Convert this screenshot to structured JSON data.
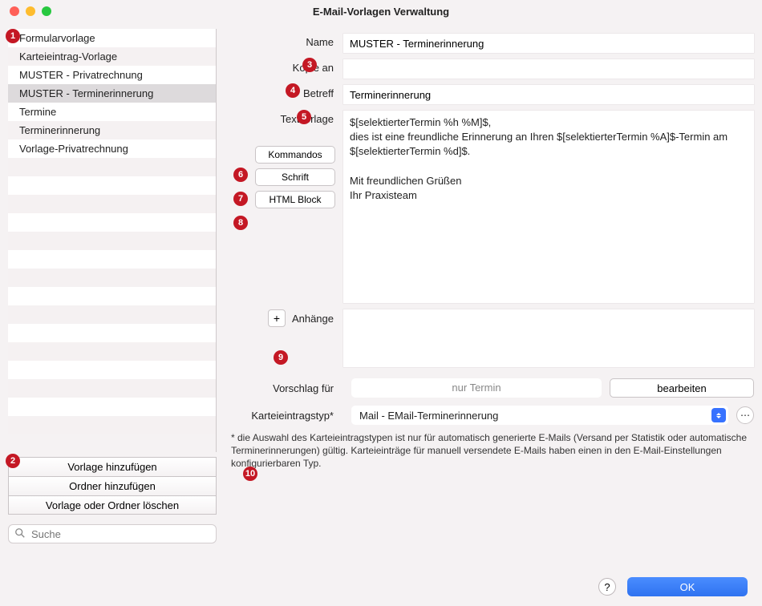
{
  "window": {
    "title": "E-Mail-Vorlagen Verwaltung"
  },
  "sidebar": {
    "items": [
      "Formularvorlage",
      "Karteieintrag-Vorlage",
      "MUSTER - Privatrechnung",
      "MUSTER - Terminerinnerung",
      "Termine",
      "Terminerinnerung",
      "Vorlage-Privatrechnung"
    ],
    "selected_index": 3,
    "buttons": {
      "add_template": "Vorlage hinzufügen",
      "add_folder": "Ordner hinzufügen",
      "delete": "Vorlage oder Ordner löschen"
    },
    "search_placeholder": "Suche"
  },
  "form": {
    "labels": {
      "name": "Name",
      "copy_to": "Kopie an",
      "subject": "Betreff",
      "template_text": "Textvorlage",
      "attachments": "Anhänge",
      "suggest_for": "Vorschlag für",
      "entry_type": "Karteieintragstyp*"
    },
    "side_buttons": {
      "commands": "Kommandos",
      "font": "Schrift",
      "html_block": "HTML Block"
    },
    "values": {
      "name": "MUSTER - Terminerinnerung",
      "copy_to": "",
      "subject": "Terminerinnerung",
      "template_text": "$[selektierterTermin %h %M]$,\ndies ist eine freundliche Erinnerung an Ihren $[selektierterTermin %A]$-Termin am $[selektierterTermin %d]$.\n\nMit freundlichen Grüßen\nIhr Praxisteam",
      "suggest_for": "nur Termin",
      "entry_type": "Mail - EMail-Terminerinnerung"
    },
    "buttons": {
      "edit": "bearbeiten",
      "ok": "OK"
    },
    "footnote": "* die Auswahl des Karteieintragstypen ist nur für automatisch generierte E-Mails (Versand per Statistik oder automatische Terminerinnerungen) gültig. Karteieinträge für manuell versendete E-Mails haben einen in den E-Mail-Einstellungen konfigurierbaren Typ."
  },
  "badges": [
    "1",
    "2",
    "3",
    "4",
    "5",
    "6",
    "7",
    "8",
    "9",
    "10"
  ]
}
